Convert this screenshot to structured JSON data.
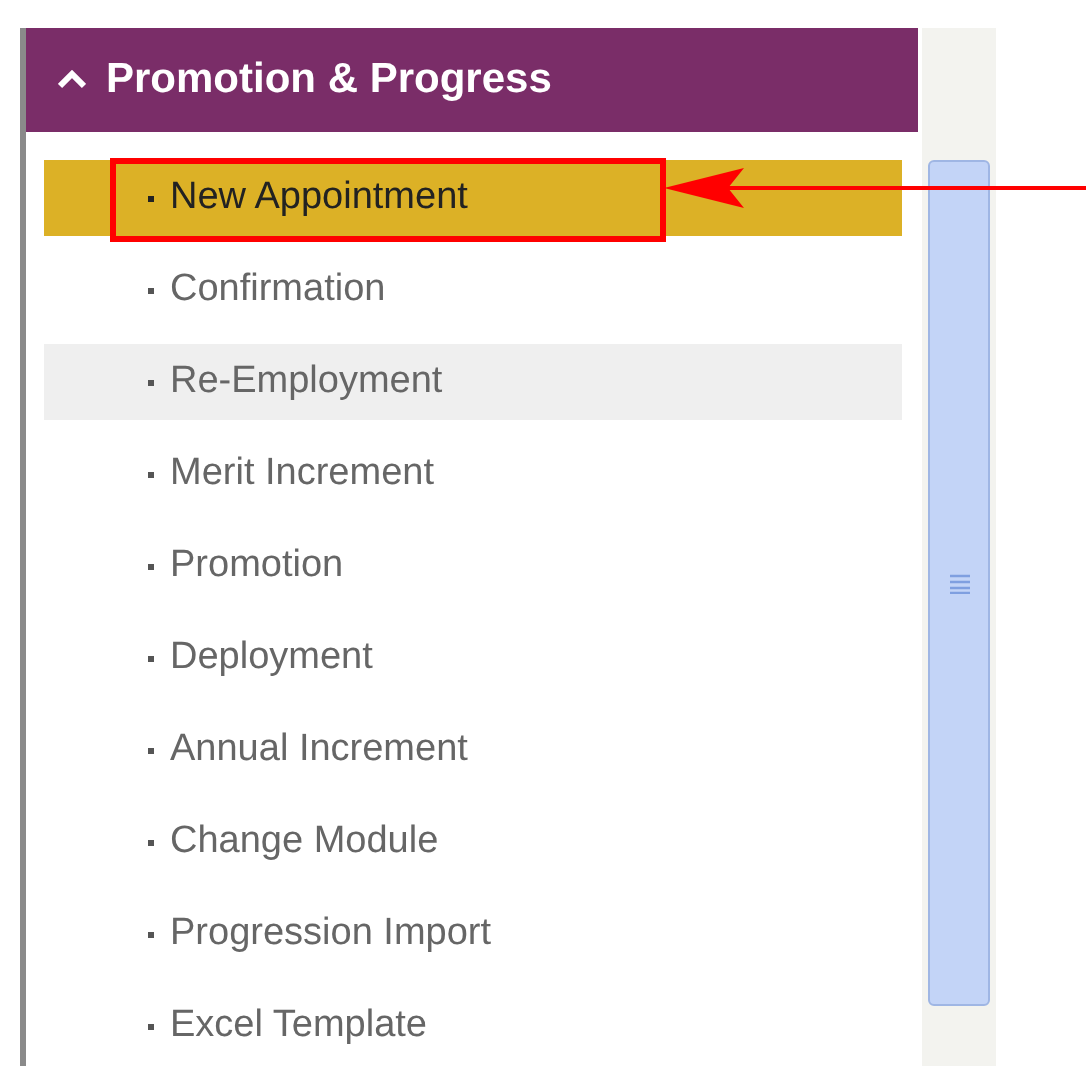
{
  "panel": {
    "title": "Promotion & Progress",
    "expanded": true,
    "items": [
      {
        "label": "New Appointment",
        "selected": true,
        "hovered": false
      },
      {
        "label": "Confirmation",
        "selected": false,
        "hovered": false
      },
      {
        "label": "Re-Employment",
        "selected": false,
        "hovered": true
      },
      {
        "label": "Merit Increment",
        "selected": false,
        "hovered": false
      },
      {
        "label": "Promotion",
        "selected": false,
        "hovered": false
      },
      {
        "label": "Deployment",
        "selected": false,
        "hovered": false
      },
      {
        "label": "Annual Increment",
        "selected": false,
        "hovered": false
      },
      {
        "label": "Change Module",
        "selected": false,
        "hovered": false
      },
      {
        "label": "Progression Import",
        "selected": false,
        "hovered": false
      },
      {
        "label": "Excel Template",
        "selected": false,
        "hovered": false
      }
    ]
  }
}
